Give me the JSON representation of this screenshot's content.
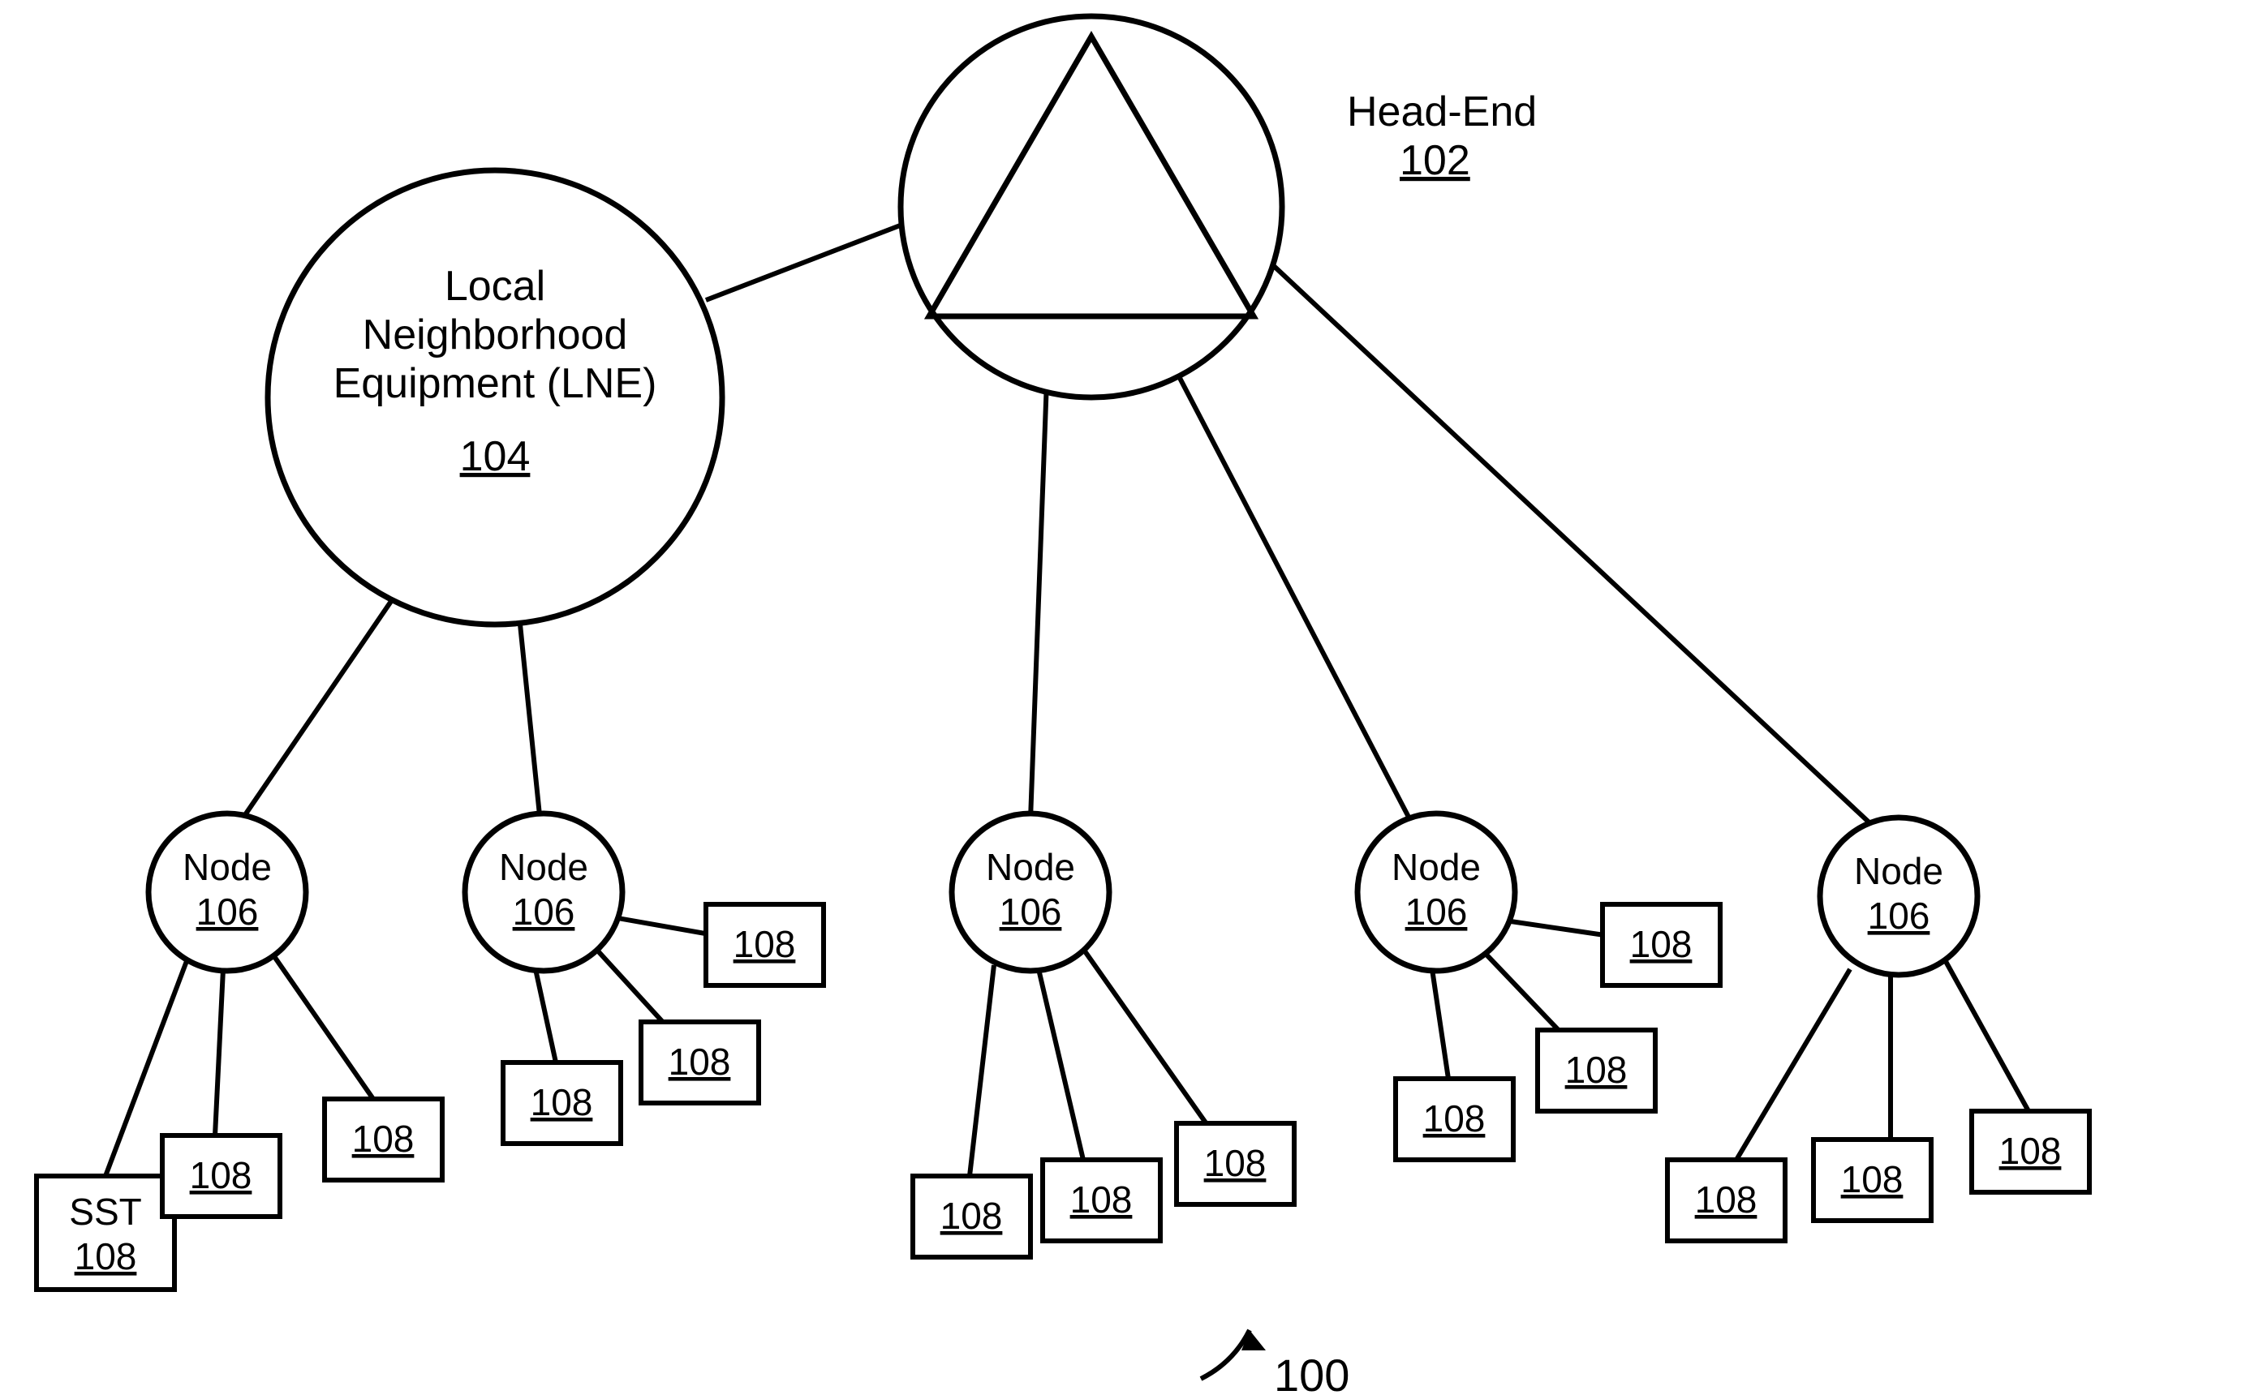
{
  "figure_ref": "100",
  "head_end": {
    "title": "Head-End",
    "ref": "102"
  },
  "lne": {
    "line1": "Local",
    "line2": "Neighborhood",
    "line3": "Equipment (LNE)",
    "ref": "104"
  },
  "node_label": "Node",
  "node_ref": "106",
  "sst_label": "SST",
  "sst_ref": "108",
  "box_ref": "108"
}
